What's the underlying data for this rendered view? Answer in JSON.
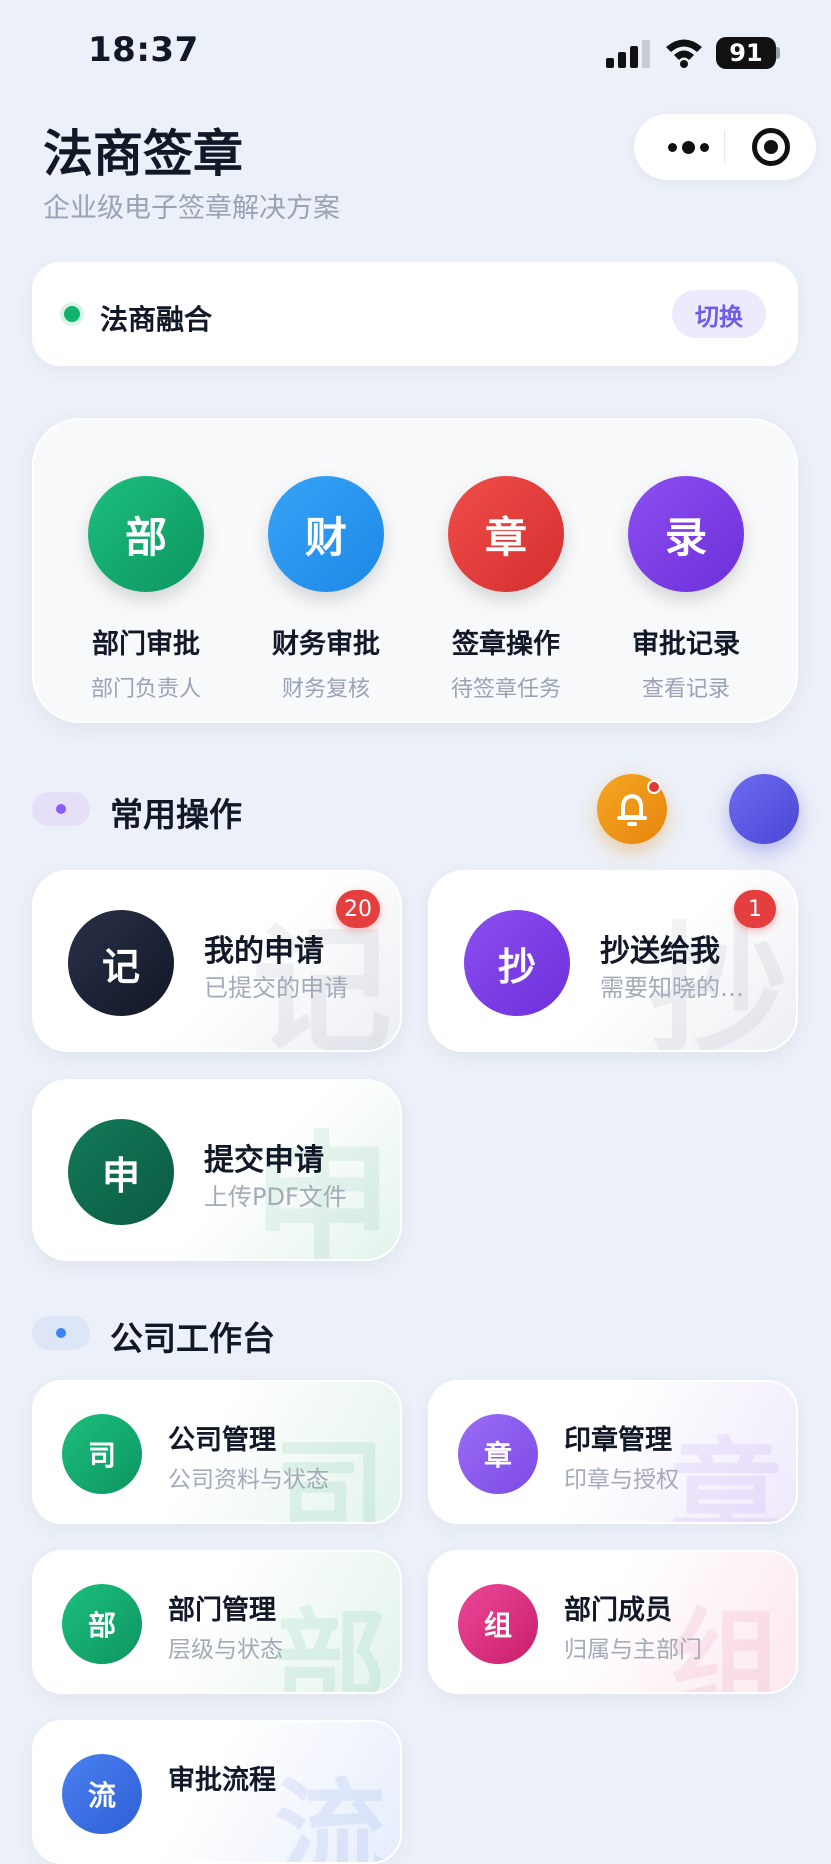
{
  "status_bar": {
    "time": "18:37",
    "battery": "91"
  },
  "header": {
    "title": "法商签章",
    "subtitle": "企业级电子签章解决方案"
  },
  "company": {
    "name": "法商融合",
    "switch_label": "切换"
  },
  "quick_actions": [
    {
      "glyph": "部",
      "label": "部门审批",
      "sub": "部门负责人",
      "color": "#10a66a"
    },
    {
      "glyph": "财",
      "label": "财务审批",
      "sub": "财务复核",
      "color": "#2196f3"
    },
    {
      "glyph": "章",
      "label": "签章操作",
      "sub": "待签章任务",
      "color": "#e53935"
    },
    {
      "glyph": "录",
      "label": "审批记录",
      "sub": "查看记录",
      "color": "#7b3fe4"
    }
  ],
  "common_ops": {
    "title": "常用操作",
    "accent": "#8b5cf6",
    "items": [
      {
        "glyph": "记",
        "title": "我的申请",
        "sub": "已提交的申请",
        "badge": "20",
        "color": "#1a2035",
        "icon": "bell-icon"
      },
      {
        "glyph": "抄",
        "title": "抄送给我",
        "sub": "需要知晓的申请",
        "badge": "1",
        "color": "#7b3fe4"
      },
      {
        "glyph": "申",
        "title": "提交申请",
        "sub": "上传PDF文件",
        "color": "#0f6b4f"
      }
    ]
  },
  "workspace": {
    "title": "公司工作台",
    "accent": "#3b82f6",
    "items": [
      {
        "glyph": "司",
        "title": "公司管理",
        "sub": "公司资料与状态",
        "color": "#10a66a",
        "tint": "#e4f4ec"
      },
      {
        "glyph": "章",
        "title": "印章管理",
        "sub": "印章与授权",
        "color": "#8b5cf6",
        "tint": "#efe9fb"
      },
      {
        "glyph": "部",
        "title": "部门管理",
        "sub": "层级与状态",
        "color": "#10a66a",
        "tint": "#e4f4ec"
      },
      {
        "glyph": "组",
        "title": "部门成员",
        "sub": "归属与主部门",
        "color": "#db2777",
        "tint": "#fbe8ef"
      },
      {
        "glyph": "流",
        "title": "审批流程",
        "sub": "",
        "color": "#3b6fe0",
        "tint": "#e6edfb"
      }
    ]
  }
}
